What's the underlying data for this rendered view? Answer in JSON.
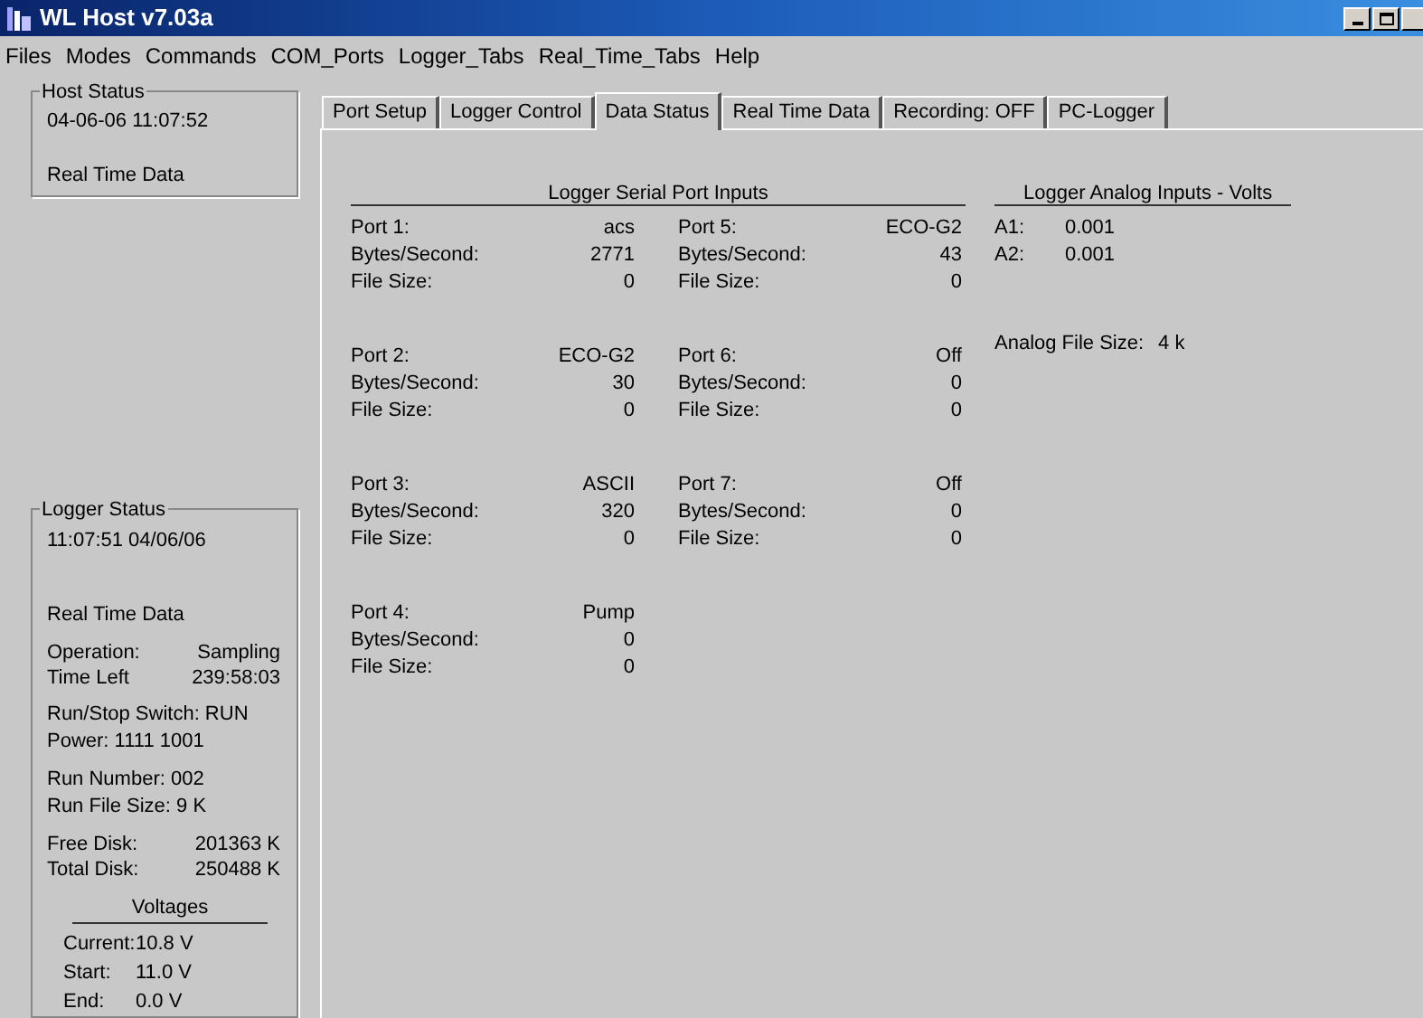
{
  "window": {
    "title": "WL Host v7.03a"
  },
  "menu": [
    "Files",
    "Modes",
    "Commands",
    "COM_Ports",
    "Logger_Tabs",
    "Real_Time_Tabs",
    "Help"
  ],
  "host_status": {
    "title": "Host Status",
    "lines": [
      "04-06-06  11:07:52",
      "Real Time Data"
    ]
  },
  "logger_status": {
    "title": "Logger Status",
    "groups": [
      [
        {
          "kind": "text",
          "text": "11:07:51  04/06/06"
        }
      ],
      [
        {
          "kind": "text",
          "text": "Real Time Data"
        }
      ],
      [
        {
          "kind": "pair",
          "label": "Operation:",
          "value": "Sampling"
        },
        {
          "kind": "pair",
          "label": "Time Left",
          "value": "239:58:03"
        }
      ],
      [
        {
          "kind": "text",
          "text": "Run/Stop Switch: RUN"
        },
        {
          "kind": "text",
          "text": "Power: 1111 1001"
        }
      ],
      [
        {
          "kind": "text",
          "text": "Run Number:  002"
        },
        {
          "kind": "text",
          "text": "Run File Size:  9 K"
        }
      ],
      [
        {
          "kind": "pair",
          "label": "Free Disk:",
          "value": "201363 K"
        },
        {
          "kind": "pair",
          "label": "Total Disk:",
          "value": "250488 K"
        }
      ]
    ],
    "voltages": {
      "title": "Voltages",
      "items": [
        {
          "label": "Current:",
          "value": "10.8 V"
        },
        {
          "label": "Start:",
          "value": "11.0 V"
        },
        {
          "label": "End:",
          "value": "0.0 V"
        }
      ]
    }
  },
  "tabs": [
    {
      "label": "Port Setup",
      "selected": false
    },
    {
      "label": "Logger Control",
      "selected": false
    },
    {
      "label": "Data Status",
      "selected": true
    },
    {
      "label": "Real Time Data",
      "selected": false
    },
    {
      "label": "Recording:  OFF",
      "selected": false
    },
    {
      "label": "PC-Logger",
      "selected": false
    }
  ],
  "serial_ports": {
    "title": "Logger Serial Port Inputs",
    "columns": [
      [
        {
          "label": "Port 1:",
          "value": "acs",
          "rows": [
            {
              "label": "Bytes/Second:",
              "value": "2771"
            },
            {
              "label": "File Size:",
              "value": "0"
            }
          ]
        },
        {
          "label": "Port 2:",
          "value": "ECO-G2",
          "rows": [
            {
              "label": "Bytes/Second:",
              "value": "30"
            },
            {
              "label": "File Size:",
              "value": "0"
            }
          ]
        },
        {
          "label": "Port 3:",
          "value": "ASCII",
          "rows": [
            {
              "label": "Bytes/Second:",
              "value": "320"
            },
            {
              "label": "File Size:",
              "value": "0"
            }
          ]
        },
        {
          "label": "Port 4:",
          "value": "Pump",
          "rows": [
            {
              "label": "Bytes/Second:",
              "value": "0"
            },
            {
              "label": "File Size:",
              "value": "0"
            }
          ]
        }
      ],
      [
        {
          "label": "Port 5:",
          "value": "ECO-G2",
          "rows": [
            {
              "label": "Bytes/Second:",
              "value": "43"
            },
            {
              "label": "File Size:",
              "value": "0"
            }
          ]
        },
        {
          "label": "Port 6:",
          "value": "Off",
          "rows": [
            {
              "label": "Bytes/Second:",
              "value": "0"
            },
            {
              "label": "File Size:",
              "value": "0"
            }
          ]
        },
        {
          "label": "Port 7:",
          "value": "Off",
          "rows": [
            {
              "label": "Bytes/Second:",
              "value": "0"
            },
            {
              "label": "File Size:",
              "value": "0"
            }
          ]
        }
      ]
    ]
  },
  "analog_inputs": {
    "title": "Logger Analog Inputs  - Volts",
    "inputs": [
      {
        "label": "A1:",
        "value": "0.001"
      },
      {
        "label": "A2:",
        "value": "0.001"
      }
    ],
    "file_size": {
      "label": "Analog File Size:",
      "value": "4 k"
    }
  }
}
